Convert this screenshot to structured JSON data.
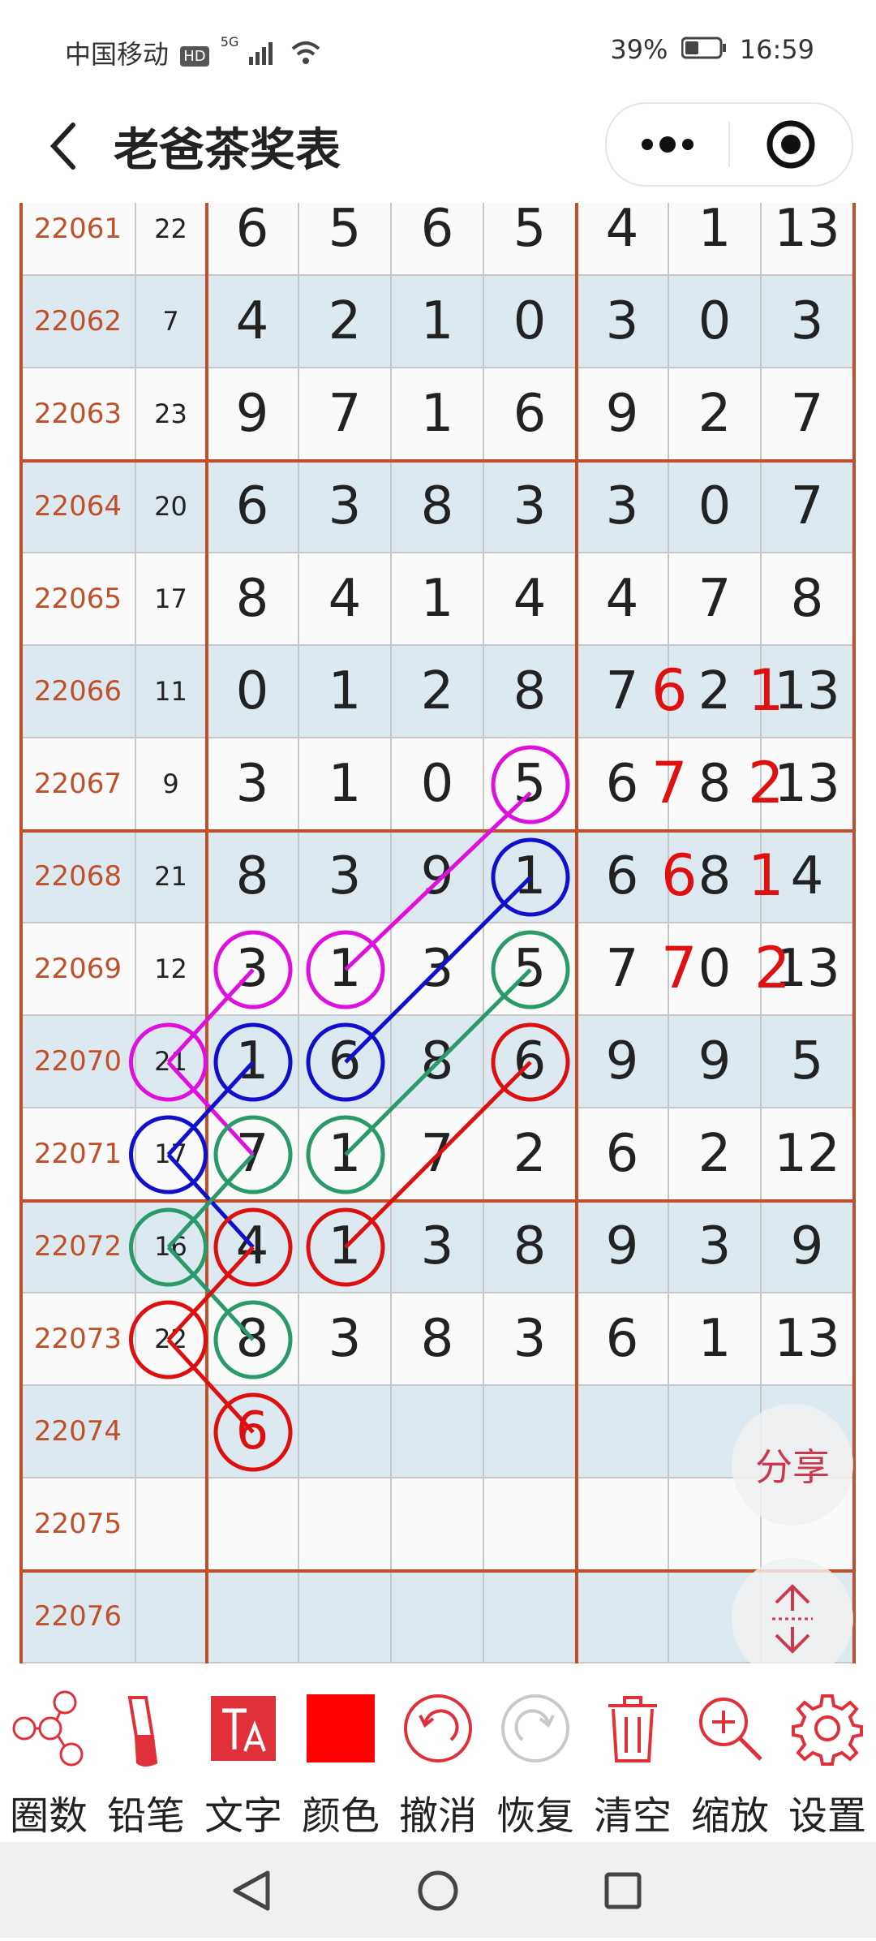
{
  "status": {
    "carrier": "中国移动",
    "hd": "HD",
    "network": "5G",
    "battery": "39%",
    "time": "16:59"
  },
  "nav": {
    "title": "老爸茶奖表",
    "back_icon": "chevron-left-icon",
    "more_icon": "more-dots-icon",
    "close_icon": "record-target-icon"
  },
  "table": {
    "rows": [
      {
        "period": "22061",
        "sum": "22",
        "d": [
          "6",
          "5",
          "6",
          "5",
          "4",
          "1",
          "13"
        ]
      },
      {
        "period": "22062",
        "sum": "7",
        "d": [
          "4",
          "2",
          "1",
          "0",
          "3",
          "0",
          "3"
        ]
      },
      {
        "period": "22063",
        "sum": "23",
        "d": [
          "9",
          "7",
          "1",
          "6",
          "9",
          "2",
          "7"
        ]
      },
      {
        "period": "22064",
        "sum": "20",
        "d": [
          "6",
          "3",
          "8",
          "3",
          "3",
          "0",
          "7"
        ]
      },
      {
        "period": "22065",
        "sum": "17",
        "d": [
          "8",
          "4",
          "1",
          "4",
          "4",
          "7",
          "8"
        ]
      },
      {
        "period": "22066",
        "sum": "11",
        "d": [
          "0",
          "1",
          "2",
          "8",
          "7",
          "2",
          "13"
        ]
      },
      {
        "period": "22067",
        "sum": "9",
        "d": [
          "3",
          "1",
          "0",
          "5",
          "6",
          "8",
          "13"
        ]
      },
      {
        "period": "22068",
        "sum": "21",
        "d": [
          "8",
          "3",
          "9",
          "1",
          "6",
          "8",
          "4"
        ]
      },
      {
        "period": "22069",
        "sum": "12",
        "d": [
          "3",
          "1",
          "3",
          "5",
          "7",
          "0",
          "13"
        ]
      },
      {
        "period": "22070",
        "sum": "21",
        "d": [
          "1",
          "6",
          "8",
          "6",
          "9",
          "9",
          "5"
        ]
      },
      {
        "period": "22071",
        "sum": "17",
        "d": [
          "7",
          "1",
          "7",
          "2",
          "6",
          "2",
          "12"
        ]
      },
      {
        "period": "22072",
        "sum": "16",
        "d": [
          "4",
          "1",
          "3",
          "8",
          "9",
          "3",
          "9"
        ]
      },
      {
        "period": "22073",
        "sum": "22",
        "d": [
          "8",
          "3",
          "8",
          "3",
          "6",
          "1",
          "13"
        ]
      },
      {
        "period": "22074",
        "sum": "",
        "d": [
          "6",
          "",
          "",
          "",
          "",
          "",
          ""
        ]
      },
      {
        "period": "22075",
        "sum": "",
        "d": [
          "",
          "",
          "",
          "",
          "",
          "",
          ""
        ]
      },
      {
        "period": "22076",
        "sum": "",
        "d": [
          "",
          "",
          "",
          "",
          "",
          "",
          ""
        ]
      }
    ],
    "annotations": [
      {
        "text": "6",
        "row": 5
      },
      {
        "text": "1",
        "row": 5
      },
      {
        "text": "7",
        "row": 6
      },
      {
        "text": "2",
        "row": 6
      },
      {
        "text": "6",
        "row": 7
      },
      {
        "text": "1",
        "row": 7
      },
      {
        "text": "7",
        "row": 8
      },
      {
        "text": "2",
        "row": 8
      }
    ]
  },
  "fab": {
    "share": "分享",
    "scroll_icon": "scroll-up-down-icon"
  },
  "toolbar": [
    {
      "label": "圈数",
      "icon": "circle-number-icon"
    },
    {
      "label": "铅笔",
      "icon": "brush-icon"
    },
    {
      "label": "文字",
      "icon": "text-icon"
    },
    {
      "label": "颜色",
      "icon": "color-swatch-icon"
    },
    {
      "label": "撤消",
      "icon": "undo-icon"
    },
    {
      "label": "恢复",
      "icon": "redo-icon"
    },
    {
      "label": "清空",
      "icon": "trash-icon"
    },
    {
      "label": "缩放",
      "icon": "zoom-in-icon"
    },
    {
      "label": "设置",
      "icon": "gear-icon"
    }
  ],
  "colors": {
    "accent": "#e0303a",
    "period_text": "#c0502a",
    "row_alt": "#dde9f1",
    "group_border": "#c0502a",
    "annotation_red": "#e01010",
    "magenta": "#dd10dd",
    "blue": "#1010cc",
    "green": "#2a9a6a",
    "red": "#dd1010"
  }
}
